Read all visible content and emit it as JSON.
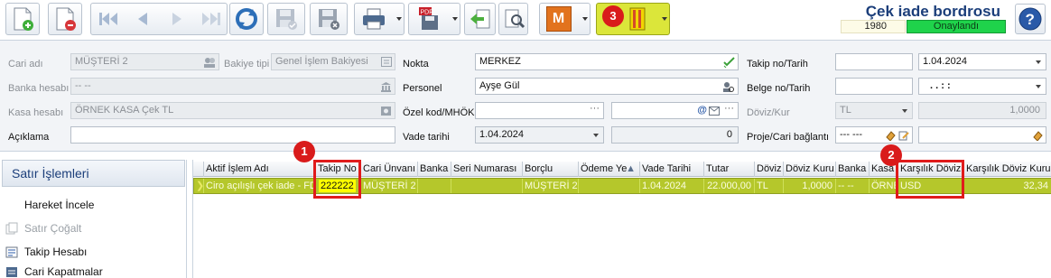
{
  "toolbar": {
    "icons": [
      "new-icon",
      "delete-icon",
      "first-icon",
      "previous-icon",
      "next-icon",
      "last-icon",
      "refresh-icon",
      "save-disabled-icon",
      "save-close-icon",
      "print-icon",
      "pdf-save-icon",
      "import-icon",
      "tools-icon",
      "m-icon",
      "menu-icon"
    ],
    "badge3": "3",
    "m_label": "M"
  },
  "document": {
    "title": "Çek iade bordrosu",
    "number": "1980",
    "status": "Onaylandı",
    "status_color": "#1fd34b"
  },
  "form": {
    "cari_adi_label": "Cari adı",
    "cari_adi_value": "MÜŞTERİ 2",
    "bakiye_tipi_label": "Bakiye tipi",
    "bakiye_tipi_value": "Genel İşlem Bakiyesi",
    "banka_hesabi_label": "Banka hesabı",
    "banka_hesabi_value": "-- --",
    "kasa_hesabi_label": "Kasa hesabı",
    "kasa_hesabi_value": "ÖRNEK KASA Çek TL",
    "aciklama_label": "Açıklama",
    "aciklama_value": "",
    "nokta_label": "Nokta",
    "nokta_value": "MERKEZ",
    "personel_label": "Personel",
    "personel_value": "Ayşe Gül",
    "ozel_kod_label": "Özel kod/MHÖK",
    "ozel_kod_value": "",
    "ozel_kod2_value": "",
    "vade_tarihi_label": "Vade tarihi",
    "vade_tarihi_value": "1.04.2024",
    "vade_count_value": "0",
    "takip_no_tarih_label": "Takip no/Tarih",
    "takip_no_value": "",
    "takip_tarih_value": "1.04.2024",
    "belge_no_tarih_label": "Belge no/Tarih",
    "belge_no_value": "",
    "belge_tarih_value": ".  .        :  :",
    "doviz_kur_label": "Döviz/Kur",
    "doviz_value": "TL",
    "kur_value": "1,0000",
    "proje_label": "Proje/Cari bağlantı",
    "proje_value": "--- ---",
    "cari_baglanti_value": ""
  },
  "side": {
    "header": "Satır İşlemleri",
    "items": [
      "Hareket İncele",
      "Satır Çoğalt",
      "Takip Hesabı",
      "Cari Kapatmalar"
    ]
  },
  "grid": {
    "columns": [
      "Aktif İşlem Adı",
      "Takip No",
      "Cari Ünvanı",
      "Banka",
      "Seri Numarası",
      "Borçlu",
      "Ödeme Ye",
      "Vade Tarihi",
      "Tutar",
      "Döviz",
      "Döviz Kuru",
      "Banka",
      "Kasa H",
      "Karşılık Dövizi",
      "Karşılık Döviz Kuru"
    ],
    "rows": [
      {
        "aktif_islem": "Ciro açılışlı çek iade - FD",
        "takip_no": "222222",
        "cari_unvani": "MÜŞTERİ 2",
        "banka": "",
        "seri_no": "",
        "borclu": "MÜŞTERİ 2",
        "odeme_yeri": "",
        "vade_tarihi": "1.04.2024",
        "tutar": "22.000,00",
        "doviz": "TL",
        "doviz_kuru": "1,0000",
        "banka2": "-- --",
        "kasa": "ÖRNE",
        "karsilik_doviz": "USD",
        "karsilik_kur": "32,34"
      }
    ],
    "row_color": "#b5c72b"
  },
  "annotations": {
    "badge1": "1",
    "badge2": "2",
    "highlight_color": "#e01b1b"
  }
}
